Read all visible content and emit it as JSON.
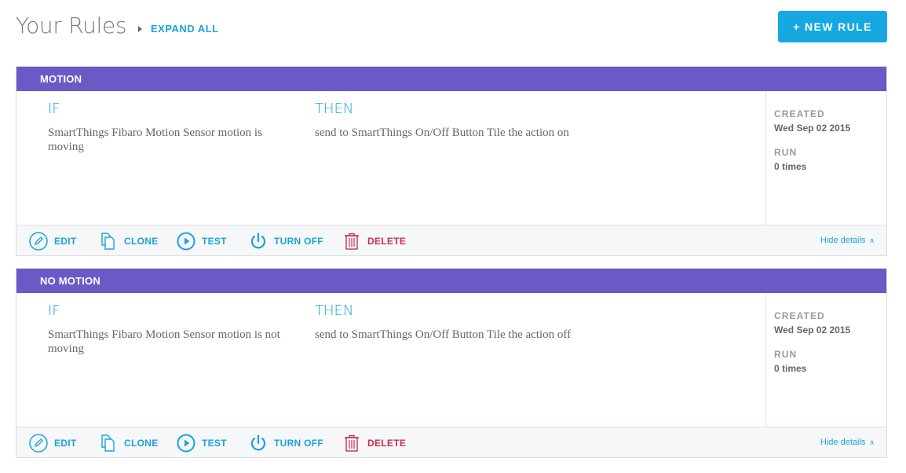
{
  "header": {
    "title": "Your Rules",
    "expand_all": "EXPAND ALL",
    "new_rule": "+ NEW RULE"
  },
  "labels": {
    "if": "IF",
    "then": "THEN",
    "created": "CREATED",
    "run": "RUN",
    "edit": "EDIT",
    "clone": "CLONE",
    "test": "TEST",
    "turn_off": "TURN OFF",
    "delete": "DELETE",
    "hide_details": "Hide details"
  },
  "rules": [
    {
      "name": "MOTION",
      "if_text": "SmartThings Fibaro Motion Sensor motion is moving",
      "then_text": "send to SmartThings On/Off Button Tile the action on",
      "created": "Wed Sep 02 2015",
      "run": "0 times"
    },
    {
      "name": "NO MOTION",
      "if_text": "SmartThings Fibaro Motion Sensor motion is not moving",
      "then_text": "send to SmartThings On/Off Button Tile the action off",
      "created": "Wed Sep 02 2015",
      "run": "0 times"
    }
  ],
  "colors": {
    "accent": "#1aa3d9",
    "rule_header": "#6a5ac7",
    "delete": "#c8304f",
    "primary_button": "#16a9e1"
  }
}
